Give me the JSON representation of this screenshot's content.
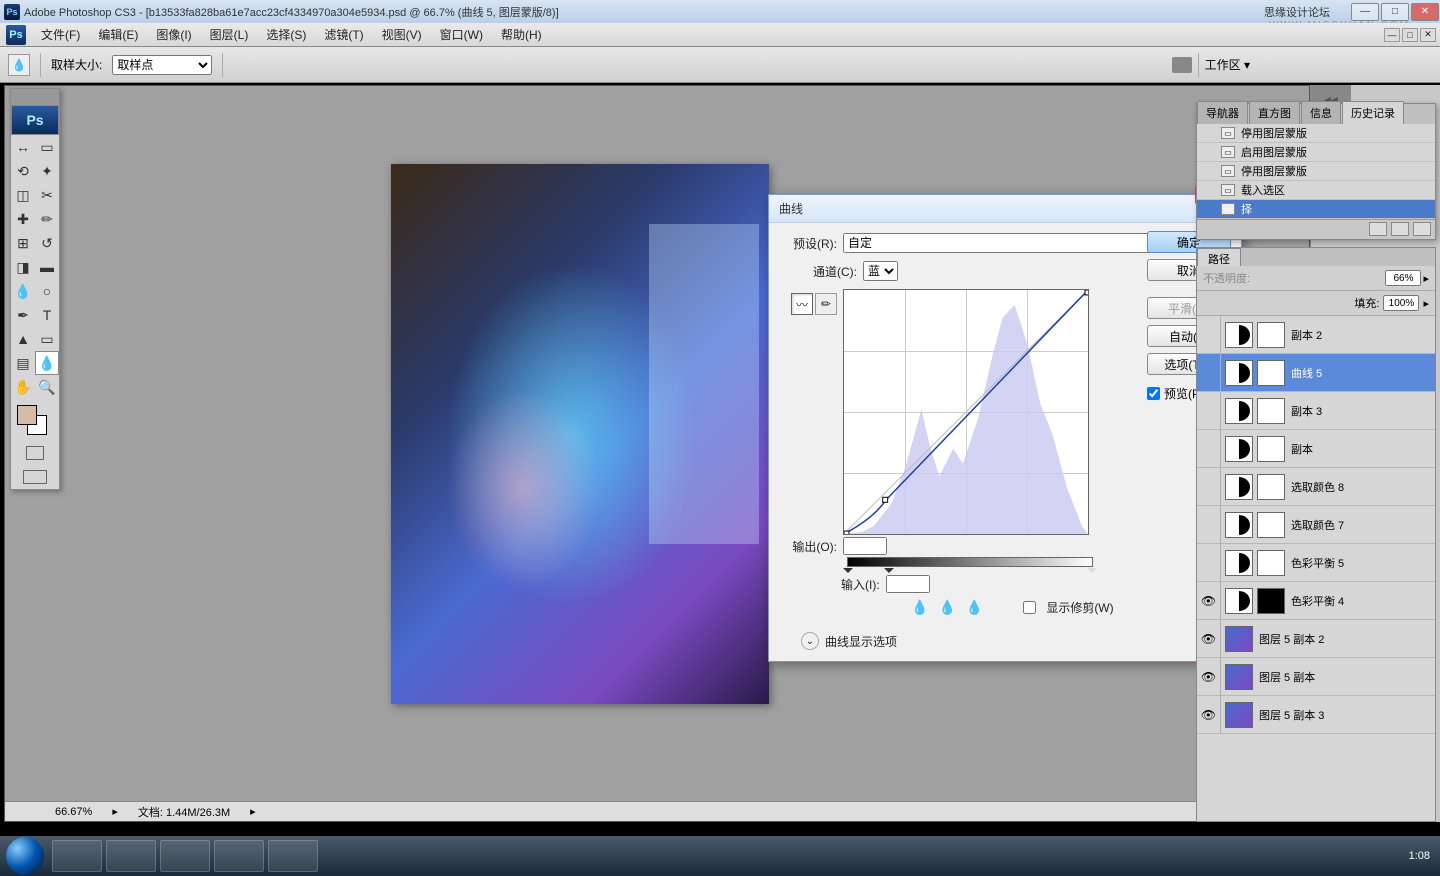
{
  "titlebar": {
    "app": "Adobe Photoshop CS3",
    "doc": "[b13533fa828ba61e7acc23cf4334970a304e5934.psd @ 66.7% (曲线 5, 图层蒙版/8)]",
    "forum": "思缘设计论坛"
  },
  "watermark": "WWW.MISSYUAN.COM",
  "menu": [
    "文件(F)",
    "编辑(E)",
    "图像(I)",
    "图层(L)",
    "选择(S)",
    "滤镜(T)",
    "视图(V)",
    "窗口(W)",
    "帮助(H)"
  ],
  "optbar": {
    "sample_label": "取样大小:",
    "sample_value": "取样点",
    "workarea": "工作区 ▾"
  },
  "status": {
    "zoom": "66.67%",
    "doc": "文档: 1.44M/26.3M"
  },
  "curves": {
    "title": "曲线",
    "preset_label": "预设(R):",
    "preset_value": "自定",
    "channel_label": "通道(C):",
    "channel_value": "蓝",
    "output_label": "输出(O):",
    "output_value": "",
    "input_label": "输入(I):",
    "input_value": "",
    "show_clip": "显示修剪(W)",
    "disp_opts": "曲线显示选项",
    "ok": "确定",
    "cancel": "取消",
    "smooth": "平滑(M)",
    "auto": "自动(A)",
    "options": "选项(T)...",
    "preview": "预览(P)"
  },
  "history": {
    "tabs": [
      "导航器",
      "直方图",
      "信息",
      "历史记录"
    ],
    "items": [
      {
        "label": "停用图层蒙版"
      },
      {
        "label": "启用图层蒙版"
      },
      {
        "label": "停用图层蒙版"
      },
      {
        "label": "载入选区"
      },
      {
        "label": "择",
        "sel": true
      }
    ]
  },
  "layers": {
    "tab": "路径",
    "opacity_label": "不透明度:",
    "opacity": "66%",
    "fill_label": "填充:",
    "fill": "100%",
    "items": [
      {
        "name": "副本 2",
        "adj": true,
        "mask": "w"
      },
      {
        "name": "曲线 5",
        "adj": true,
        "mask": "w",
        "sel": true
      },
      {
        "name": "副本 3",
        "adj": true,
        "mask": "w"
      },
      {
        "name": "副本",
        "adj": true,
        "mask": "w"
      },
      {
        "name": "选取颜色 8",
        "adj": true,
        "mask": "w"
      },
      {
        "name": "选取颜色 7",
        "adj": true,
        "mask": "w"
      },
      {
        "name": "色彩平衡 5",
        "adj": true,
        "mask": "w"
      },
      {
        "name": "色彩平衡 4",
        "adj": true,
        "mask": "b",
        "eye": true
      },
      {
        "name": "图层 5 副本 2",
        "adj": false,
        "eye": true
      },
      {
        "name": "图层 5 副本",
        "adj": false,
        "eye": true
      },
      {
        "name": "图层 5 副本 3",
        "adj": false,
        "eye": true
      }
    ]
  },
  "clock": {
    "time": "1:08"
  }
}
